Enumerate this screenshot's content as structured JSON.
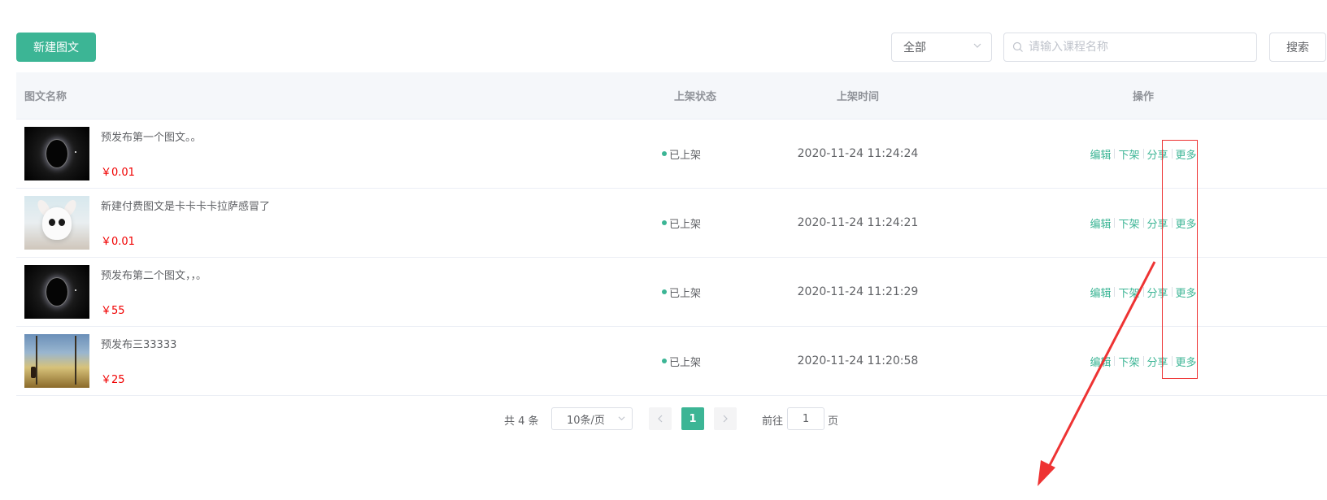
{
  "toolbar": {
    "new_button": "新建图文",
    "status_select_value": "全部",
    "search_placeholder": "请输入课程名称",
    "search_button": "搜索"
  },
  "table": {
    "headers": {
      "name": "图文名称",
      "status": "上架状态",
      "time": "上架时间",
      "ops": "操作"
    },
    "rows": [
      {
        "title": "预发布第一个图文。。",
        "price": "￥0.01",
        "status": "已上架",
        "time": "2020-11-24 11:24:24",
        "thumb": "space-planet"
      },
      {
        "title": "新建付费图文是卡卡卡卡拉萨感冒了",
        "price": "￥0.01",
        "status": "已上架",
        "time": "2020-11-24 11:24:21",
        "thumb": "white-bunny"
      },
      {
        "title": "预发布第二个图文，，。",
        "price": "￥55",
        "status": "已上架",
        "time": "2020-11-24 11:21:29",
        "thumb": "space-planet"
      },
      {
        "title": "预发布三33333",
        "price": "￥25",
        "status": "已上架",
        "time": "2020-11-24 11:20:58",
        "thumb": "landscape"
      }
    ],
    "actions": {
      "edit": "编辑",
      "unpublish": "下架",
      "share": "分享",
      "more": "更多"
    }
  },
  "pagination": {
    "total": "共 4 条",
    "page_size": "10条/页",
    "current_page": "1",
    "goto_label": "前往",
    "goto_value": "1",
    "page_unit": "页"
  },
  "colors": {
    "primary": "#3cb595",
    "price": "#f00000",
    "annotation": "#e33333"
  }
}
